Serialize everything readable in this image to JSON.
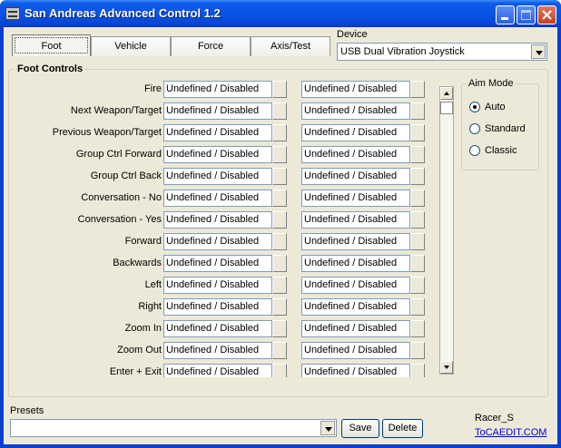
{
  "window": {
    "title": "San Andreas Advanced Control 1.2"
  },
  "tabs": [
    "Foot",
    "Vehicle",
    "Force",
    "Axis/Test"
  ],
  "device": {
    "label": "Device",
    "value": "USB Dual Vibration Joystick"
  },
  "foot_controls": {
    "label": "Foot Controls",
    "rows": [
      {
        "label": "Fire",
        "primary": "Undefined / Disabled",
        "secondary": "Undefined / Disabled"
      },
      {
        "label": "Next Weapon/Target",
        "primary": "Undefined / Disabled",
        "secondary": "Undefined / Disabled"
      },
      {
        "label": "Previous Weapon/Target",
        "primary": "Undefined / Disabled",
        "secondary": "Undefined / Disabled"
      },
      {
        "label": "Group Ctrl Forward",
        "primary": "Undefined / Disabled",
        "secondary": "Undefined / Disabled"
      },
      {
        "label": "Group Ctrl Back",
        "primary": "Undefined / Disabled",
        "secondary": "Undefined / Disabled"
      },
      {
        "label": "Conversation - No",
        "primary": "Undefined / Disabled",
        "secondary": "Undefined / Disabled"
      },
      {
        "label": "Conversation - Yes",
        "primary": "Undefined / Disabled",
        "secondary": "Undefined / Disabled"
      },
      {
        "label": "Forward",
        "primary": "Undefined / Disabled",
        "secondary": "Undefined / Disabled"
      },
      {
        "label": "Backwards",
        "primary": "Undefined / Disabled",
        "secondary": "Undefined / Disabled"
      },
      {
        "label": "Left",
        "primary": "Undefined / Disabled",
        "secondary": "Undefined / Disabled"
      },
      {
        "label": "Right",
        "primary": "Undefined / Disabled",
        "secondary": "Undefined / Disabled"
      },
      {
        "label": "Zoom In",
        "primary": "Undefined / Disabled",
        "secondary": "Undefined / Disabled"
      },
      {
        "label": "Zoom Out",
        "primary": "Undefined / Disabled",
        "secondary": "Undefined / Disabled"
      },
      {
        "label": "Enter + Exit",
        "primary": "Undefined / Disabled",
        "secondary": "Undefined / Disabled"
      }
    ]
  },
  "aim_mode": {
    "label": "Aim Mode",
    "options": [
      "Auto",
      "Standard",
      "Classic"
    ],
    "selected": "Auto"
  },
  "presets": {
    "label": "Presets",
    "value": "",
    "save_label": "Save",
    "delete_label": "Delete"
  },
  "footer": {
    "author": "Racer_S",
    "link": "ToCAEDIT.COM"
  }
}
